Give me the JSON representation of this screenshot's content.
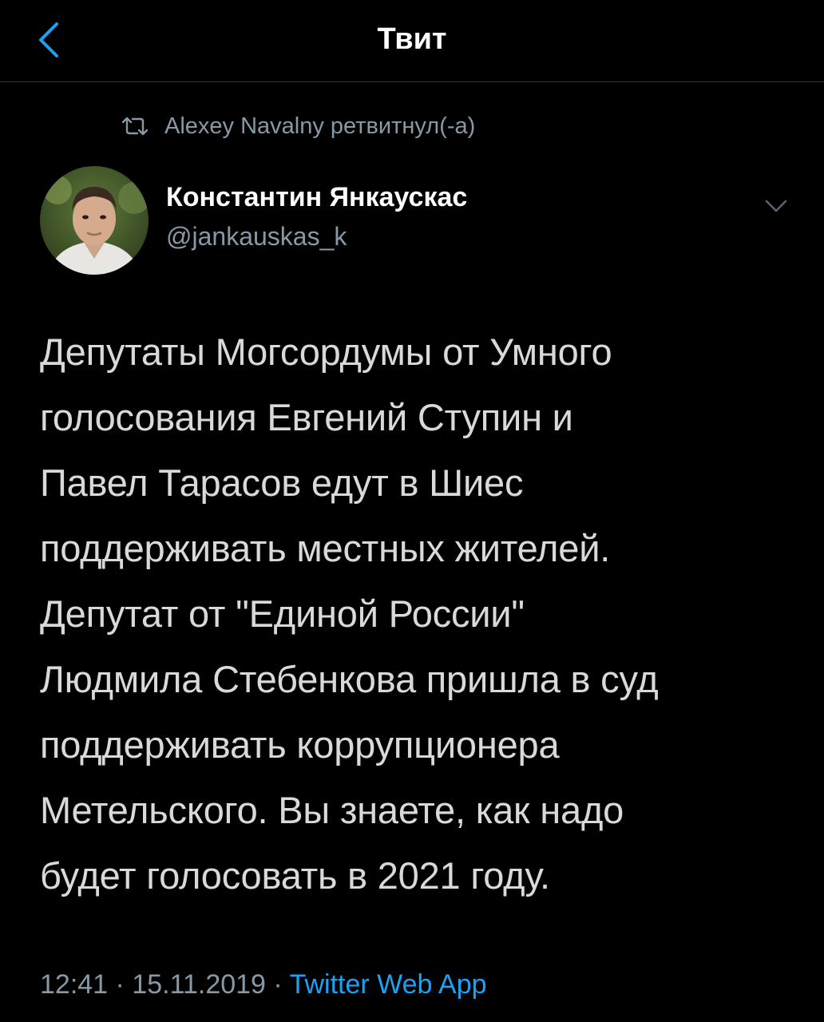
{
  "colors": {
    "background": "#000000",
    "text": "#d9d9d9",
    "secondary": "#8899a6",
    "accent": "#1da1f2",
    "divider": "#2f3336"
  },
  "nav": {
    "back_icon": "chevron-left-icon",
    "title": "Твит"
  },
  "retweet": {
    "icon": "retweet-icon",
    "text": "Alexey Navalny ретвитнул(-а)"
  },
  "author": {
    "avatar": "avatar-photo",
    "name": "Константин Янкаускас",
    "handle": "@jankauskas_k",
    "more_icon": "chevron-down-icon"
  },
  "tweet": {
    "lines": [
      "Депутаты Могсордумы от Умного",
      "голосования Евгений Ступин и",
      "Павел Тарасов едут в Шиес",
      "поддерживать местных жителей.",
      "Депутат от \"Единой России\"",
      "Людмила Стебенкова пришла в суд",
      "поддерживать коррупционера",
      "Метельского. Вы знаете, как надо",
      "будет голосовать в 2021 году."
    ]
  },
  "meta": {
    "time": "12:41",
    "separator": " · ",
    "date": "15.11.2019",
    "source": "Twitter Web App"
  }
}
